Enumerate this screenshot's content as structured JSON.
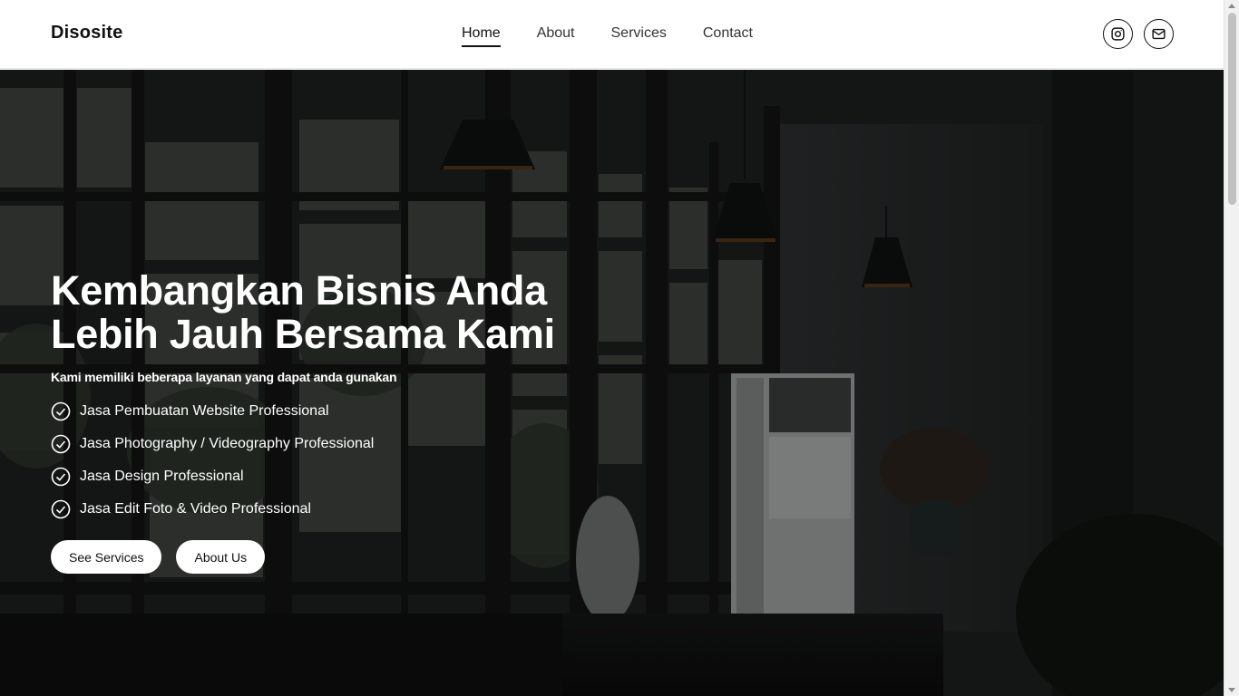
{
  "navbar": {
    "brand": "Disosite",
    "links": [
      {
        "label": "Home",
        "active": true
      },
      {
        "label": "About",
        "active": false
      },
      {
        "label": "Services",
        "active": false
      },
      {
        "label": "Contact",
        "active": false
      }
    ],
    "socials": [
      {
        "icon": "instagram-icon"
      },
      {
        "icon": "mail-icon"
      }
    ]
  },
  "hero": {
    "title_line1": "Kembangkan Bisnis Anda",
    "title_line2": "Lebih Jauh Bersama Kami",
    "subtitle": "Kami memiliki beberapa layanan yang dapat anda gunakan",
    "services": [
      "Jasa Pembuatan Website Professional",
      "Jasa Photography / Videography Professional",
      "Jasa Design Professional",
      "Jasa Edit Foto & Video Professional"
    ],
    "buttons": {
      "primary": "See Services",
      "secondary": "About Us"
    }
  },
  "colors": {
    "text_dark": "#111111",
    "hero_overlay": "#17191a",
    "button_bg": "#ffffff"
  }
}
